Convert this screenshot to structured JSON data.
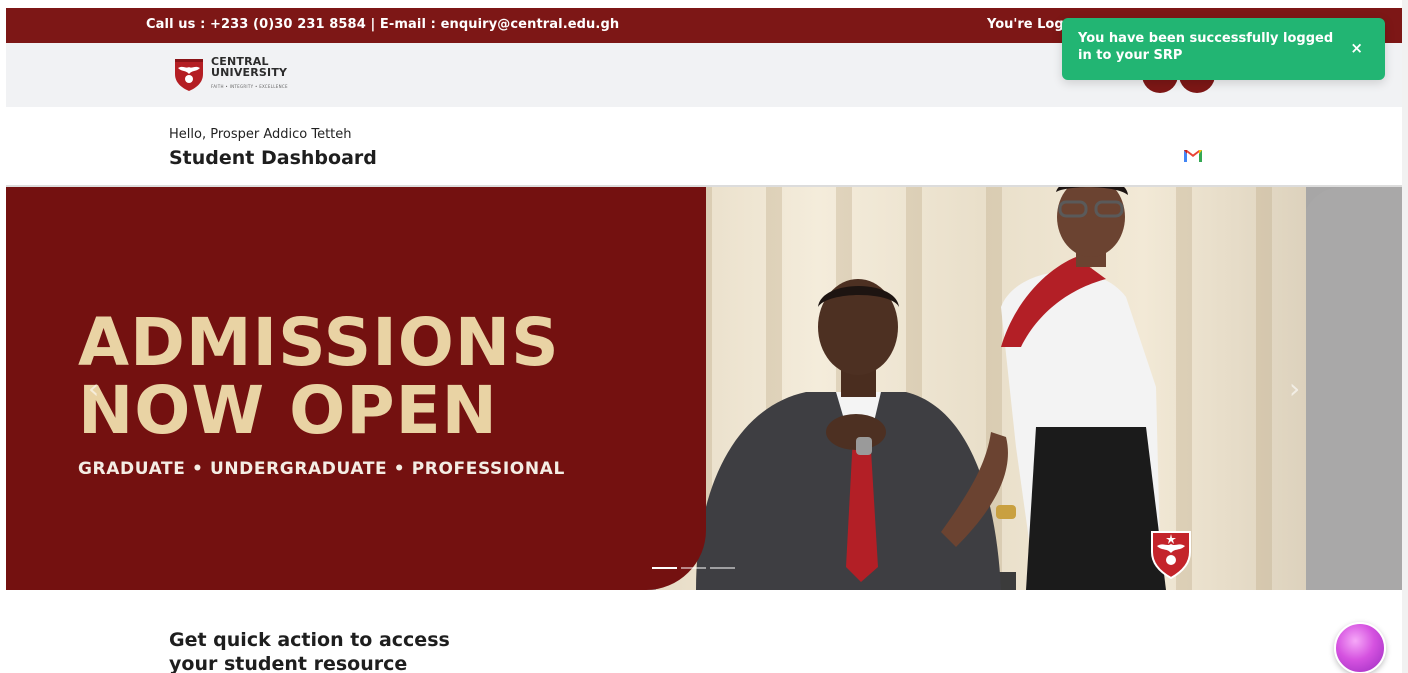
{
  "topbar": {
    "contact": "Call us : +233 (0)30 231 8584 | E-mail : enquiry@central.edu.gh",
    "logged_status": "You're Logge"
  },
  "logo": {
    "line1": "CENTRAL",
    "line2": "UNIVERSITY",
    "tagline": "FAITH • INTEGRITY • EXCELLENCE"
  },
  "greeting": {
    "hello": "Hello, Prosper Addico Tetteh",
    "title": "Student Dashboard"
  },
  "banner": {
    "headline_line1": "ADMISSIONS",
    "headline_line2": "NOW OPEN",
    "subline": "GRADUATE • UNDERGRADUATE • PROFESSIONAL",
    "slide_count": 3,
    "active_slide": 1
  },
  "quick_action": {
    "line1": "Get quick action to access",
    "line2": "your student resource"
  },
  "toast": {
    "message": "You have been successfully logged in to your SRP",
    "close_label": "×"
  },
  "colors": {
    "brand_red": "#741110",
    "topbar_red": "#7d1716",
    "headline_gold": "#e9d3a4",
    "toast_green": "#22b573"
  },
  "icons": {
    "gmail": "gmail-icon",
    "prev": "chevron-left-icon",
    "next": "chevron-right-icon",
    "chat": "chat-orb-icon"
  }
}
